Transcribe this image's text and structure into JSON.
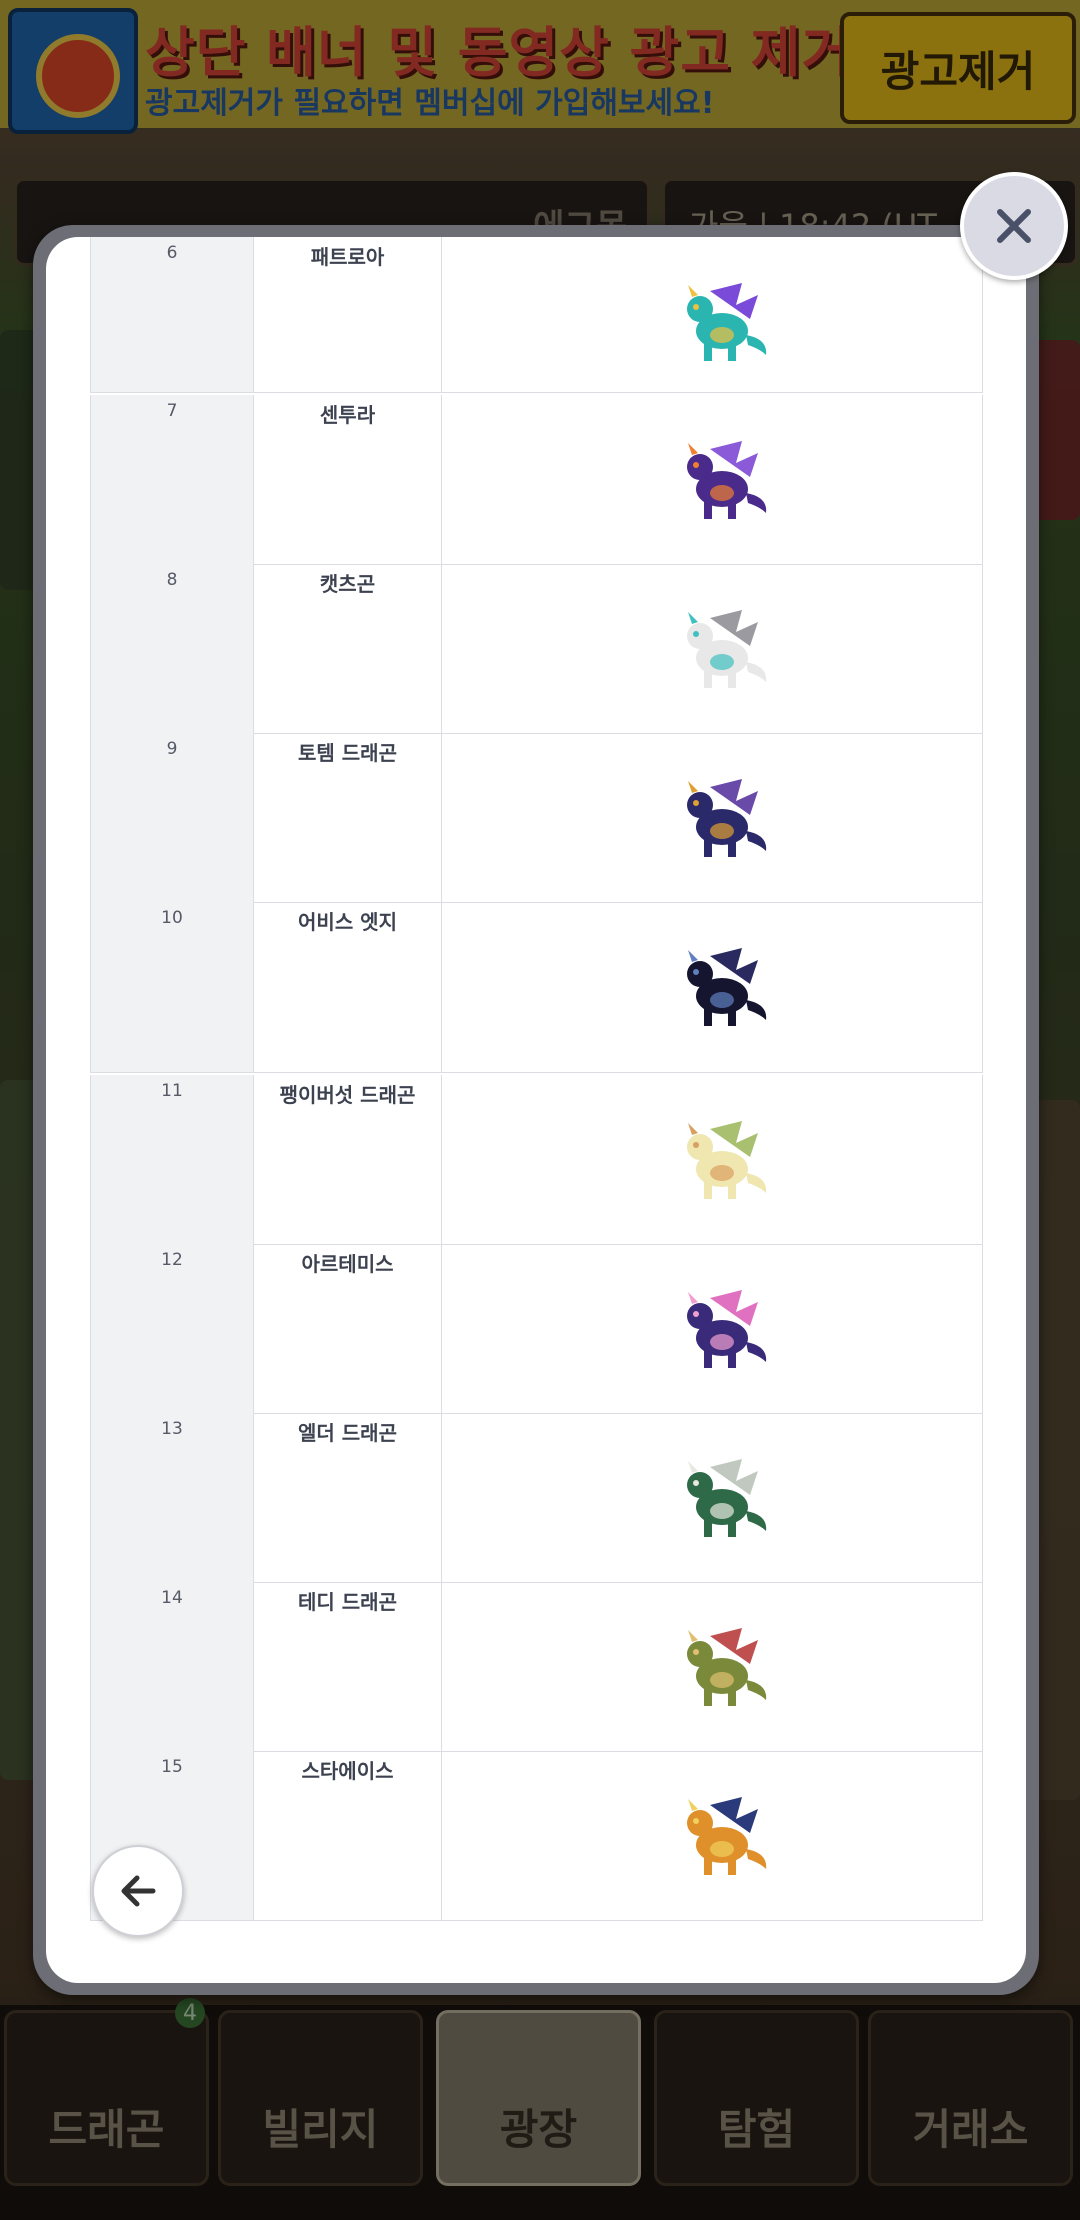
{
  "ad_banner": {
    "title": "상단 배너 및 동영상 광고 제거!",
    "subtitle": "광고제거가 필요하면 멤버십에 가입해보세요!",
    "button_label": "광고제거"
  },
  "top_bar": {
    "name": "에그몽",
    "status": "가을 | 18:42 (UT"
  },
  "bottom_nav": {
    "tabs": [
      {
        "label": "드래곤"
      },
      {
        "label": "빌리지"
      },
      {
        "label": "광장"
      },
      {
        "label": "탐험"
      },
      {
        "label": "거래소"
      }
    ],
    "dragon_badge": "4",
    "active": "광장"
  },
  "modal": {
    "close_icon": "close-icon",
    "back_icon": "arrow-left-icon",
    "rows": [
      {
        "num": "6",
        "name": "패트로아",
        "icon": "dragon-cyan",
        "colors": [
          "#2bb5b0",
          "#7a4ad8",
          "#f0c040"
        ]
      },
      {
        "num": "7",
        "name": "센투라",
        "icon": "dragon-purple",
        "colors": [
          "#4a2a8a",
          "#8a5ad8",
          "#f08030"
        ]
      },
      {
        "num": "8",
        "name": "캣츠곤",
        "icon": "dragon-white",
        "colors": [
          "#e8e8e8",
          "#9a9aa0",
          "#40c0c0"
        ]
      },
      {
        "num": "9",
        "name": "토템 드래곤",
        "icon": "dragon-navy",
        "colors": [
          "#2a2a6a",
          "#6a4aa8",
          "#e0a030"
        ]
      },
      {
        "num": "10",
        "name": "어비스 엣지",
        "icon": "dragon-black",
        "colors": [
          "#151530",
          "#2a2a60",
          "#6080c0"
        ]
      },
      {
        "num": "11",
        "name": "팽이버섯 드래곤",
        "icon": "dragon-cream",
        "colors": [
          "#f0e6b0",
          "#a8c070",
          "#d8a060"
        ]
      },
      {
        "num": "12",
        "name": "아르테미스",
        "icon": "dragon-violet",
        "colors": [
          "#3a2a7a",
          "#e070c0",
          "#f0a0d0"
        ]
      },
      {
        "num": "13",
        "name": "엘더 드래곤",
        "icon": "dragon-green",
        "colors": [
          "#2e6a48",
          "#c0c8c0",
          "#e8e8e0"
        ]
      },
      {
        "num": "14",
        "name": "테디 드래곤",
        "icon": "dragon-olive",
        "colors": [
          "#7a8a3a",
          "#c05050",
          "#e0c070"
        ]
      },
      {
        "num": "15",
        "name": "스타에이스",
        "icon": "dragon-gold",
        "colors": [
          "#e0902a",
          "#2a3a7a",
          "#f0d060"
        ]
      }
    ]
  }
}
